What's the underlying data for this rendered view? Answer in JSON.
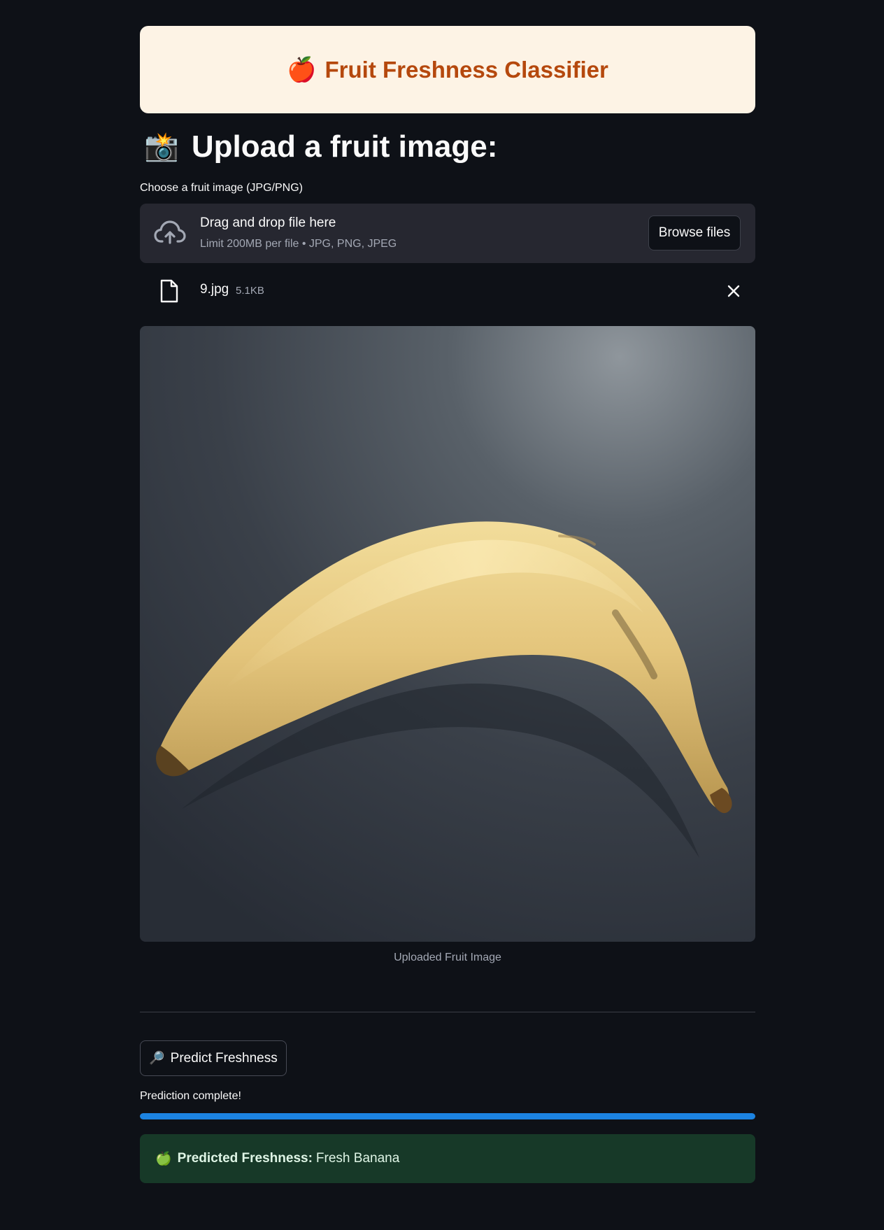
{
  "header": {
    "icon": "🍎",
    "title": "Fruit Freshness Classifier"
  },
  "upload_section": {
    "icon": "📸",
    "heading": "Upload a fruit image:"
  },
  "uploader": {
    "label": "Choose a fruit image (JPG/PNG)",
    "drop_text": "Drag and drop file here",
    "limit_text": "Limit 200MB per file • JPG, PNG, JPEG",
    "browse_label": "Browse files",
    "icon": "cloud-upload-icon"
  },
  "uploaded_file": {
    "name": "9.jpg",
    "size": "5.1KB",
    "icon": "file-icon"
  },
  "image": {
    "caption": "Uploaded Fruit Image",
    "subject": "banana photo"
  },
  "predict_button": {
    "icon": "🔎",
    "label": "Predict Freshness"
  },
  "progress": {
    "status": "Prediction complete!",
    "value": 1.0,
    "color": "#1c83e1"
  },
  "result": {
    "icon": "🍏",
    "label": "Predicted Freshness:",
    "value": "Fresh Banana"
  },
  "colors": {
    "background": "#0e1117",
    "title_accent": "#b5480d",
    "title_card": "#fdf3e5",
    "success_bg": "#173928"
  }
}
